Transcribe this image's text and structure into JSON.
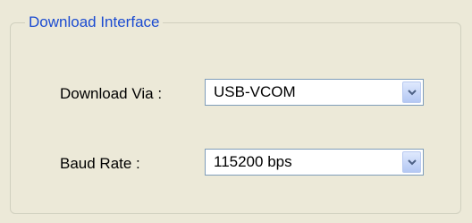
{
  "group": {
    "title": "Download Interface"
  },
  "fields": [
    {
      "label": "Download Via :",
      "value": "USB-VCOM"
    },
    {
      "label": "Baud Rate :",
      "value": "115200 bps"
    }
  ],
  "icons": {
    "dropdown": "chevron-down-icon"
  },
  "colors": {
    "background": "#ece9d8",
    "group_title": "#1b4bd1",
    "combo_border": "#7f9db9",
    "chevron": "#4d6185"
  }
}
